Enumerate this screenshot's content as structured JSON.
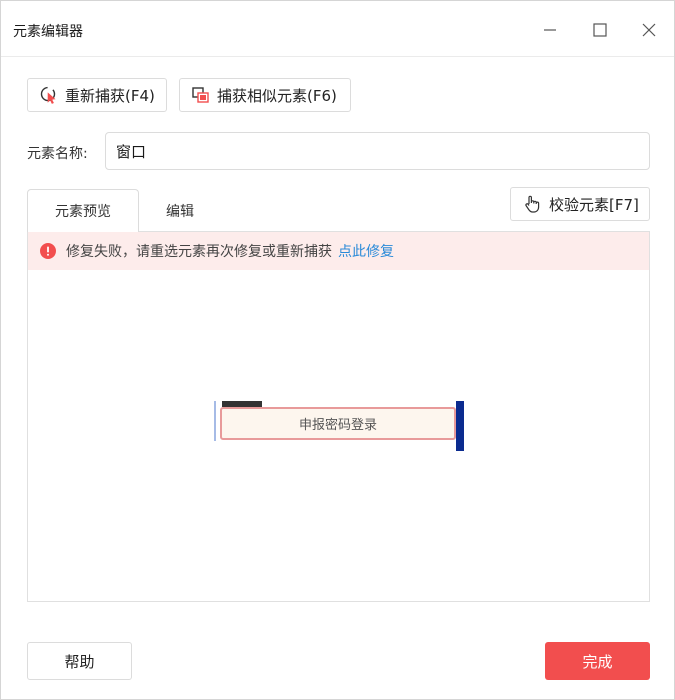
{
  "window": {
    "title": "元素编辑器"
  },
  "toolbar": {
    "recapture_label": "重新捕获(F4)",
    "capture_similar_label": "捕获相似元素(F6)"
  },
  "element_name": {
    "label": "元素名称:",
    "value": "窗口"
  },
  "tabs": [
    {
      "label": "元素预览",
      "active": true
    },
    {
      "label": "编辑",
      "active": false
    }
  ],
  "verify_button": {
    "label": "校验元素[F7]"
  },
  "alert": {
    "message": "修复失败，请重选元素再次修复或重新捕获",
    "link_label": "点此修复"
  },
  "preview": {
    "button_text": "申报密码登录"
  },
  "footer": {
    "help_label": "帮助",
    "done_label": "完成"
  },
  "colors": {
    "primary": "#f24e4e",
    "link": "#2a8ad8",
    "alert_bg": "#fdeceb",
    "error_icon": "#f24e4e"
  },
  "icons": {
    "recapture": "recapture-cursor-icon",
    "capture_similar": "capture-similar-icon",
    "verify": "hand-pointer-icon",
    "alert": "error-circle-icon"
  }
}
